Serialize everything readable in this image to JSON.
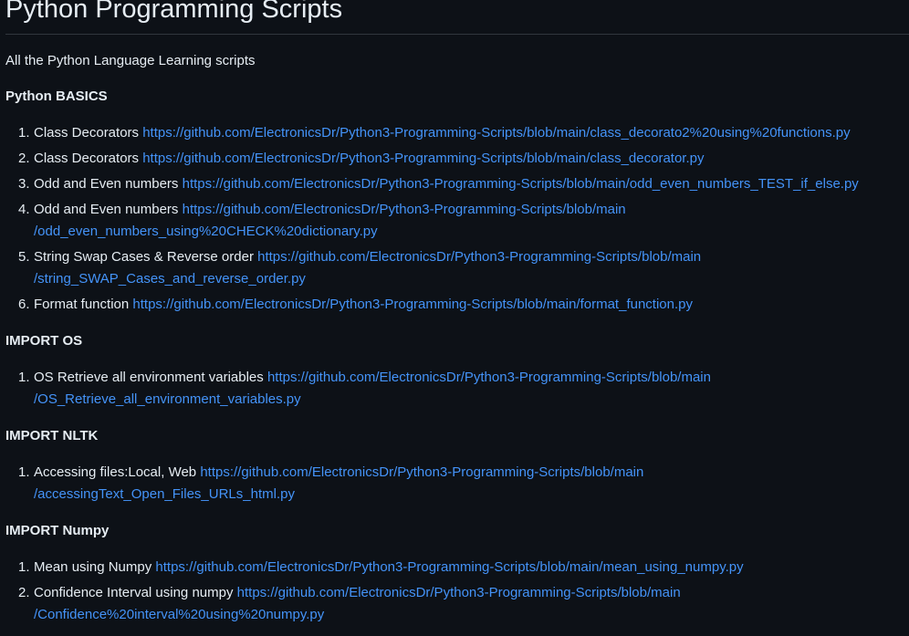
{
  "title": "Python Programming Scripts",
  "intro": "All the Python Language Learning scripts",
  "sections": [
    {
      "heading": "Python BASICS",
      "items": [
        {
          "num": "1.",
          "label": "Class Decorators",
          "url": "https://github.com/ElectronicsDr/Python3-Programming-Scripts/blob/main/class_decorato2%20using%20functions.py"
        },
        {
          "num": "2.",
          "label": "Class Decorators",
          "url": "https://github.com/ElectronicsDr/Python3-Programming-Scripts/blob/main/class_decorator.py"
        },
        {
          "num": "3.",
          "label": "Odd and Even numbers",
          "url": "https://github.com/ElectronicsDr/Python3-Programming-Scripts/blob/main/odd_even_numbers_TEST_if_else.py"
        },
        {
          "num": "4.",
          "label": "Odd and Even numbers",
          "url": "https://github.com/ElectronicsDr/Python3-Programming-Scripts/blob/main",
          "url_cont": "/odd_even_numbers_using%20CHECK%20dictionary.py"
        },
        {
          "num": "5.",
          "label": "String Swap Cases & Reverse order",
          "url": "https://github.com/ElectronicsDr/Python3-Programming-Scripts/blob/main",
          "url_cont": "/string_SWAP_Cases_and_reverse_order.py"
        },
        {
          "num": "6.",
          "label": "Format function",
          "url": "https://github.com/ElectronicsDr/Python3-Programming-Scripts/blob/main/format_function.py"
        }
      ]
    },
    {
      "heading": "IMPORT OS",
      "items": [
        {
          "num": "1.",
          "label": "OS Retrieve all environment variables",
          "url": "https://github.com/ElectronicsDr/Python3-Programming-Scripts/blob/main",
          "url_cont": "/OS_Retrieve_all_environment_variables.py"
        }
      ]
    },
    {
      "heading": "IMPORT NLTK",
      "items": [
        {
          "num": "1.",
          "label": "Accessing files:Local, Web",
          "url": "https://github.com/ElectronicsDr/Python3-Programming-Scripts/blob/main",
          "url_cont": "/accessingText_Open_Files_URLs_html.py"
        }
      ]
    },
    {
      "heading": "IMPORT Numpy",
      "items": [
        {
          "num": "1.",
          "label": "Mean using Numpy",
          "url": "https://github.com/ElectronicsDr/Python3-Programming-Scripts/blob/main/mean_using_numpy.py"
        },
        {
          "num": "2.",
          "label": "Confidence Interval using numpy",
          "url": "https://github.com/ElectronicsDr/Python3-Programming-Scripts/blob/main",
          "url_cont": "/Confidence%20interval%20using%20numpy.py"
        }
      ]
    }
  ]
}
